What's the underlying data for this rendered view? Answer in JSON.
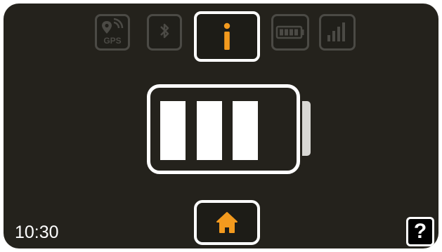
{
  "status_bar": {
    "gps_label": "GPS",
    "info_symbol": "i",
    "icons": [
      "gps-icon",
      "bluetooth-icon",
      "info-icon",
      "battery-icon",
      "signal-icon"
    ],
    "active_icon": "info-icon"
  },
  "battery_display": {
    "level_bars_filled": 3,
    "level_bars_total": 3
  },
  "footer": {
    "time": "10:30",
    "help_symbol": "?"
  },
  "colors": {
    "screen_background": "#24221c",
    "accent": "#f39a1e",
    "inactive_icon": "#4b4a45",
    "active_border": "#ffffff"
  }
}
